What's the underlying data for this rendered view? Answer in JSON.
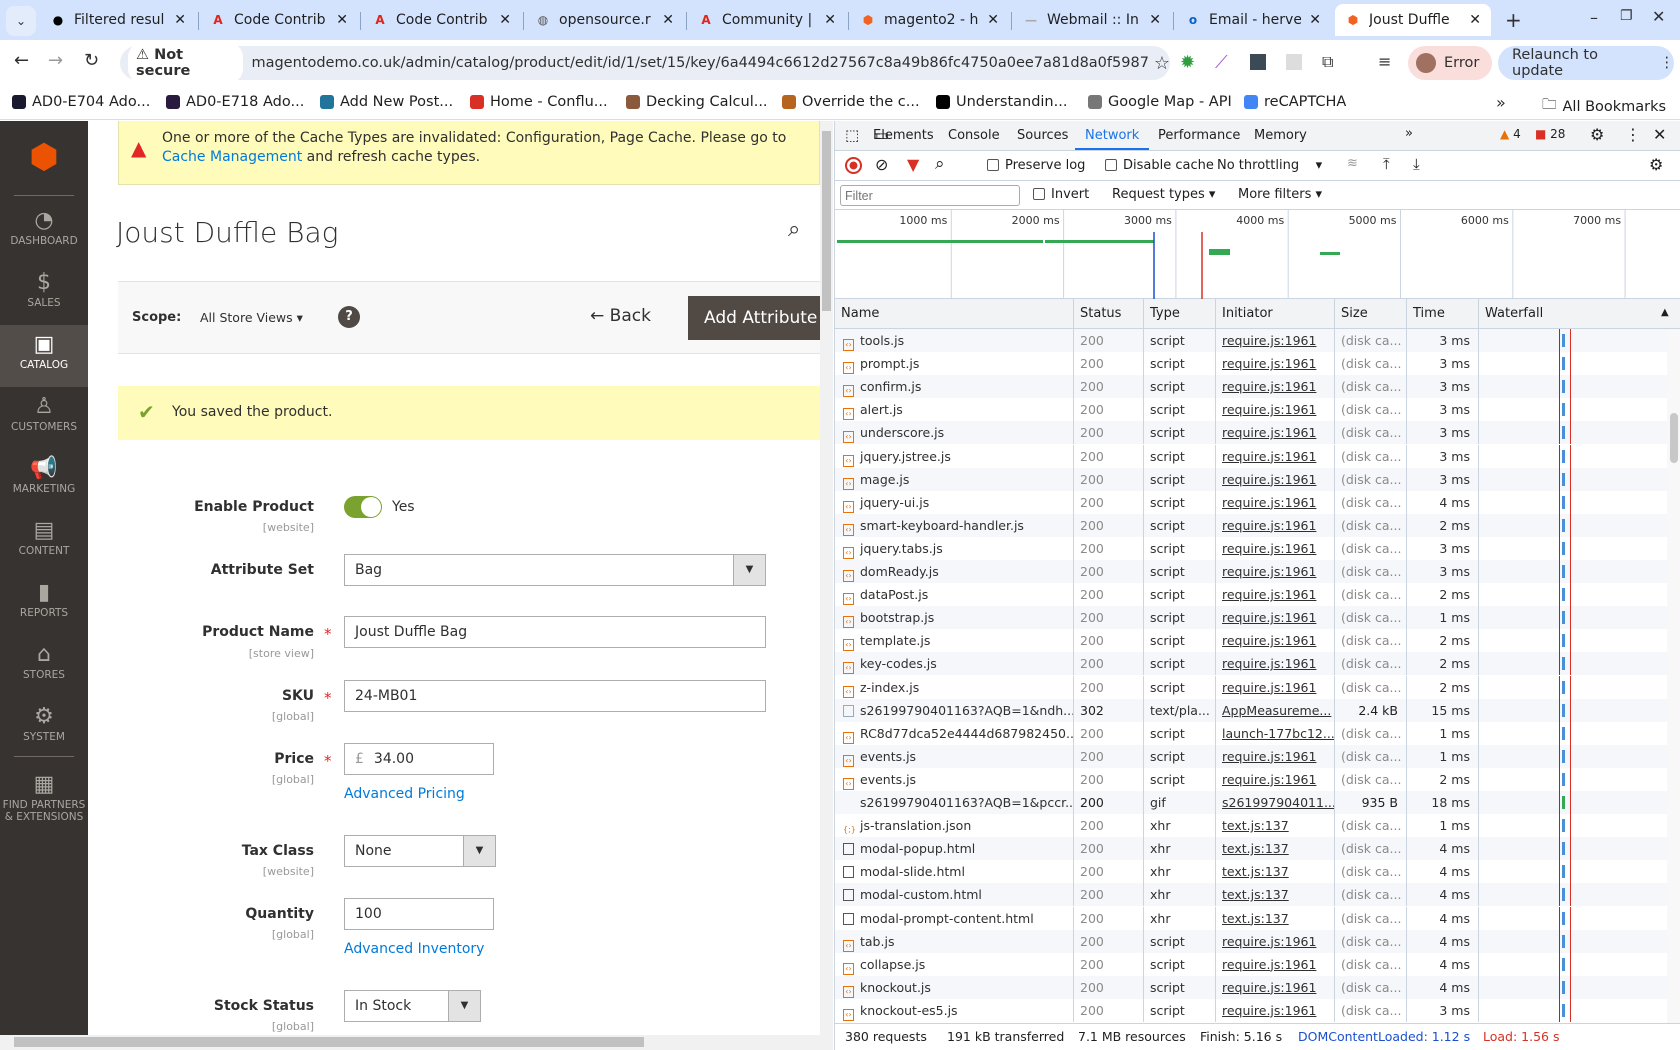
{
  "browser": {
    "tabs": [
      {
        "title": "Filtered resul",
        "icon": "github-icon"
      },
      {
        "title": "Code Contrib",
        "icon": "adobe-icon"
      },
      {
        "title": "Code Contrib",
        "icon": "adobe-icon"
      },
      {
        "title": "opensource.r",
        "icon": "globe-icon"
      },
      {
        "title": "Community |",
        "icon": "adobe-icon"
      },
      {
        "title": "magento2 - h",
        "icon": "magento-icon"
      },
      {
        "title": "Webmail :: In",
        "icon": "webmail-icon"
      },
      {
        "title": "Email - herve",
        "icon": "outlook-icon"
      },
      {
        "title": "Joust Duffle",
        "icon": "magento-icon",
        "active": true
      }
    ],
    "security_label": "Not secure",
    "url": "magentodemo.co.uk/admin/catalog/product/edit/id/1/set/15/key/6a4494c6612d27567c8a49b86fc4750a0ee7a81d8a0f5987100f2877ba...",
    "profile_label": "Error",
    "relaunch_label": "Relaunch to update",
    "bookmarks": [
      "AD0-E704 Ado...",
      "AD0-E718 Ado...",
      "Add New Post...",
      "Home - Conflu...",
      "Decking Calcul...",
      "Override the c...",
      "Understandin...",
      "Google Map - API",
      "reCAPTCHA"
    ],
    "all_bookmarks": "All Bookmarks"
  },
  "sidebar": {
    "items": [
      {
        "label": "DASHBOARD",
        "icon": "dashboard-icon"
      },
      {
        "label": "SALES",
        "icon": "dollar-icon"
      },
      {
        "label": "CATALOG",
        "icon": "box-icon",
        "active": true
      },
      {
        "label": "CUSTOMERS",
        "icon": "person-icon"
      },
      {
        "label": "MARKETING",
        "icon": "megaphone-icon"
      },
      {
        "label": "CONTENT",
        "icon": "layout-icon"
      },
      {
        "label": "REPORTS",
        "icon": "bar-chart-icon"
      },
      {
        "label": "STORES",
        "icon": "store-icon"
      },
      {
        "label": "SYSTEM",
        "icon": "gear-icon"
      },
      {
        "label": "FIND PARTNERS & EXTENSIONS",
        "icon": "blocks-icon"
      }
    ]
  },
  "page": {
    "alert_text": "One or more of the Cache Types are invalidated: Configuration, Page Cache. Please go to",
    "alert_link": "Cache Management",
    "alert_tail": "and refresh cache types.",
    "title": "Joust Duffle Bag",
    "scope_label": "Scope:",
    "scope_value": "All Store Views",
    "back_label": "Back",
    "add_attribute_label": "Add Attribute",
    "success_message": "You saved the product."
  },
  "form": {
    "enable_product": {
      "label": "Enable Product",
      "scope": "[website]",
      "value": "Yes",
      "on": true
    },
    "attribute_set": {
      "label": "Attribute Set",
      "value": "Bag"
    },
    "product_name": {
      "label": "Product Name",
      "scope": "[store view]",
      "value": "Joust Duffle Bag"
    },
    "sku": {
      "label": "SKU",
      "scope": "[global]",
      "value": "24-MB01"
    },
    "price": {
      "label": "Price",
      "scope": "[global]",
      "currency": "£",
      "value": "34.00",
      "link": "Advanced Pricing"
    },
    "tax_class": {
      "label": "Tax Class",
      "scope": "[website]",
      "value": "None"
    },
    "quantity": {
      "label": "Quantity",
      "scope": "[global]",
      "value": "100",
      "link": "Advanced Inventory"
    },
    "stock_status": {
      "label": "Stock Status",
      "scope": "[global]",
      "value": "In Stock"
    }
  },
  "devtools": {
    "tabs": [
      "Elements",
      "Console",
      "Sources",
      "Network",
      "Performance",
      "Memory"
    ],
    "active_tab": "Network",
    "warnings": "4",
    "errors": "28",
    "preserve_log": "Preserve log",
    "disable_cache": "Disable cache",
    "throttling": "No throttling",
    "filter_placeholder": "Filter",
    "invert": "Invert",
    "request_types": "Request types",
    "more_filters": "More filters",
    "timeline_ticks": [
      "1000 ms",
      "2000 ms",
      "3000 ms",
      "4000 ms",
      "5000 ms",
      "6000 ms",
      "7000 ms"
    ],
    "columns": [
      "Name",
      "Status",
      "Type",
      "Initiator",
      "Size",
      "Time",
      "Waterfall"
    ],
    "rows": [
      [
        "tools.js",
        "200",
        "script",
        "require.js:1961",
        "(disk ca...",
        "3 ms",
        "script"
      ],
      [
        "prompt.js",
        "200",
        "script",
        "require.js:1961",
        "(disk ca...",
        "3 ms",
        "script"
      ],
      [
        "confirm.js",
        "200",
        "script",
        "require.js:1961",
        "(disk ca...",
        "3 ms",
        "script"
      ],
      [
        "alert.js",
        "200",
        "script",
        "require.js:1961",
        "(disk ca...",
        "3 ms",
        "script"
      ],
      [
        "underscore.js",
        "200",
        "script",
        "require.js:1961",
        "(disk ca...",
        "3 ms",
        "script"
      ],
      [
        "jquery.jstree.js",
        "200",
        "script",
        "require.js:1961",
        "(disk ca...",
        "3 ms",
        "script"
      ],
      [
        "mage.js",
        "200",
        "script",
        "require.js:1961",
        "(disk ca...",
        "3 ms",
        "script"
      ],
      [
        "jquery-ui.js",
        "200",
        "script",
        "require.js:1961",
        "(disk ca...",
        "4 ms",
        "script"
      ],
      [
        "smart-keyboard-handler.js",
        "200",
        "script",
        "require.js:1961",
        "(disk ca...",
        "2 ms",
        "script"
      ],
      [
        "jquery.tabs.js",
        "200",
        "script",
        "require.js:1961",
        "(disk ca...",
        "3 ms",
        "script"
      ],
      [
        "domReady.js",
        "200",
        "script",
        "require.js:1961",
        "(disk ca...",
        "3 ms",
        "script"
      ],
      [
        "dataPost.js",
        "200",
        "script",
        "require.js:1961",
        "(disk ca...",
        "2 ms",
        "script"
      ],
      [
        "bootstrap.js",
        "200",
        "script",
        "require.js:1961",
        "(disk ca...",
        "1 ms",
        "script"
      ],
      [
        "template.js",
        "200",
        "script",
        "require.js:1961",
        "(disk ca...",
        "2 ms",
        "script"
      ],
      [
        "key-codes.js",
        "200",
        "script",
        "require.js:1961",
        "(disk ca...",
        "2 ms",
        "script"
      ],
      [
        "z-index.js",
        "200",
        "script",
        "require.js:1961",
        "(disk ca...",
        "2 ms",
        "script"
      ],
      [
        "s26199790401163?AQB=1&ndh...",
        "302",
        "text/pla...",
        "AppMeasureme...",
        "2.4 kB",
        "15 ms",
        "image"
      ],
      [
        "RC8d77dca52e4444d687982450...",
        "200",
        "script",
        "launch-177bc12...",
        "(disk ca...",
        "1 ms",
        "script"
      ],
      [
        "events.js",
        "200",
        "script",
        "require.js:1961",
        "(disk ca...",
        "1 ms",
        "script"
      ],
      [
        "events.js",
        "200",
        "script",
        "require.js:1961",
        "(disk ca...",
        "2 ms",
        "script"
      ],
      [
        "s26199790401163?AQB=1&pccr...",
        "200",
        "gif",
        "s261997904011...",
        "935 B",
        "18 ms",
        "none"
      ],
      [
        "js-translation.json",
        "200",
        "xhr",
        "text.js:137",
        "(disk ca...",
        "1 ms",
        "json"
      ],
      [
        "modal-popup.html",
        "200",
        "xhr",
        "text.js:137",
        "(disk ca...",
        "4 ms",
        "doc"
      ],
      [
        "modal-slide.html",
        "200",
        "xhr",
        "text.js:137",
        "(disk ca...",
        "4 ms",
        "doc"
      ],
      [
        "modal-custom.html",
        "200",
        "xhr",
        "text.js:137",
        "(disk ca...",
        "4 ms",
        "doc"
      ],
      [
        "modal-prompt-content.html",
        "200",
        "xhr",
        "text.js:137",
        "(disk ca...",
        "4 ms",
        "doc"
      ],
      [
        "tab.js",
        "200",
        "script",
        "require.js:1961",
        "(disk ca...",
        "4 ms",
        "script"
      ],
      [
        "collapse.js",
        "200",
        "script",
        "require.js:1961",
        "(disk ca...",
        "4 ms",
        "script"
      ],
      [
        "knockout.js",
        "200",
        "script",
        "require.js:1961",
        "(disk ca...",
        "4 ms",
        "script"
      ],
      [
        "knockout-es5.js",
        "200",
        "script",
        "require.js:1961",
        "(disk ca...",
        "3 ms",
        "script"
      ]
    ],
    "summary": {
      "requests": "380 requests",
      "transferred": "191 kB transferred",
      "resources": "7.1 MB resources",
      "finish": "Finish: 5.16 s",
      "dom_content_loaded": "DOMContentLoaded: 1.12 s",
      "load": "Load: 1.56 s"
    },
    "colors": {
      "accent": "#1a73e8",
      "dcl": "#1a4fd0",
      "load": "#d93025",
      "bar": "#34a853"
    }
  }
}
